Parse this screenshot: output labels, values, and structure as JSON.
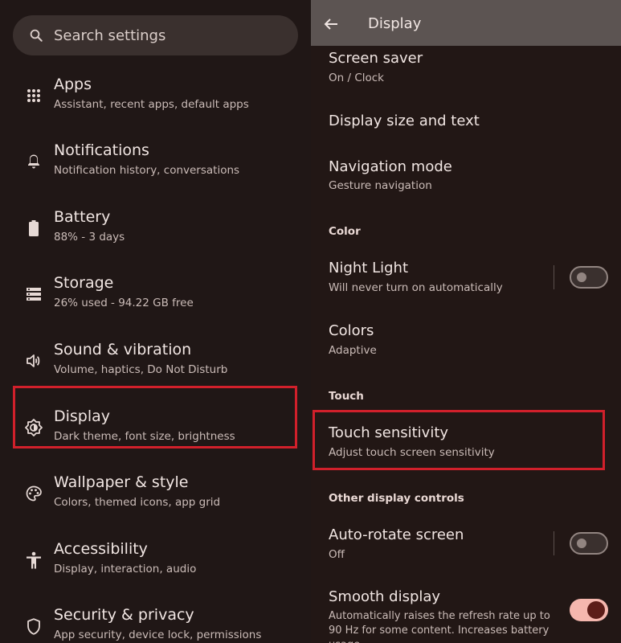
{
  "left": {
    "search": {
      "placeholder": "Search settings"
    },
    "items": [
      {
        "title": "Apps",
        "sub": "Assistant, recent apps, default apps",
        "icon": "apps-grid-icon"
      },
      {
        "title": "Notifications",
        "sub": "Notification history, conversations",
        "icon": "bell-icon"
      },
      {
        "title": "Battery",
        "sub": "88% - 3 days",
        "icon": "battery-icon"
      },
      {
        "title": "Storage",
        "sub": "26% used - 94.22 GB free",
        "icon": "storage-icon"
      },
      {
        "title": "Sound & vibration",
        "sub": "Volume, haptics, Do Not Disturb",
        "icon": "speaker-icon"
      },
      {
        "title": "Display",
        "sub": "Dark theme, font size, brightness",
        "icon": "brightness-icon"
      },
      {
        "title": "Wallpaper & style",
        "sub": "Colors, themed icons, app grid",
        "icon": "palette-icon"
      },
      {
        "title": "Accessibility",
        "sub": "Display, interaction, audio",
        "icon": "accessibility-icon"
      },
      {
        "title": "Security & privacy",
        "sub": "App security, device lock, permissions",
        "icon": "shield-icon"
      }
    ]
  },
  "right": {
    "title": "Display",
    "screen_saver": {
      "title": "Screen saver",
      "sub": "On / Clock"
    },
    "display_size": {
      "title": "Display size and text"
    },
    "navigation_mode": {
      "title": "Navigation mode",
      "sub": "Gesture navigation"
    },
    "color_header": "Color",
    "night_light": {
      "title": "Night Light",
      "sub": "Will never turn on automatically",
      "enabled": false
    },
    "colors": {
      "title": "Colors",
      "sub": "Adaptive"
    },
    "touch_header": "Touch",
    "touch_sensitivity": {
      "title": "Touch sensitivity",
      "sub": "Adjust touch screen sensitivity"
    },
    "other_header": "Other display controls",
    "auto_rotate": {
      "title": "Auto-rotate screen",
      "sub": "Off",
      "enabled": false
    },
    "smooth_display": {
      "title": "Smooth display",
      "sub": "Automatically raises the refresh rate up to 90 Hz for some content. Increases battery usage.",
      "enabled": true
    }
  },
  "colors": {
    "highlight": "#d1202b",
    "toggle_on_track": "#f5b7ae",
    "toggle_on_knob": "#5c1d18"
  }
}
